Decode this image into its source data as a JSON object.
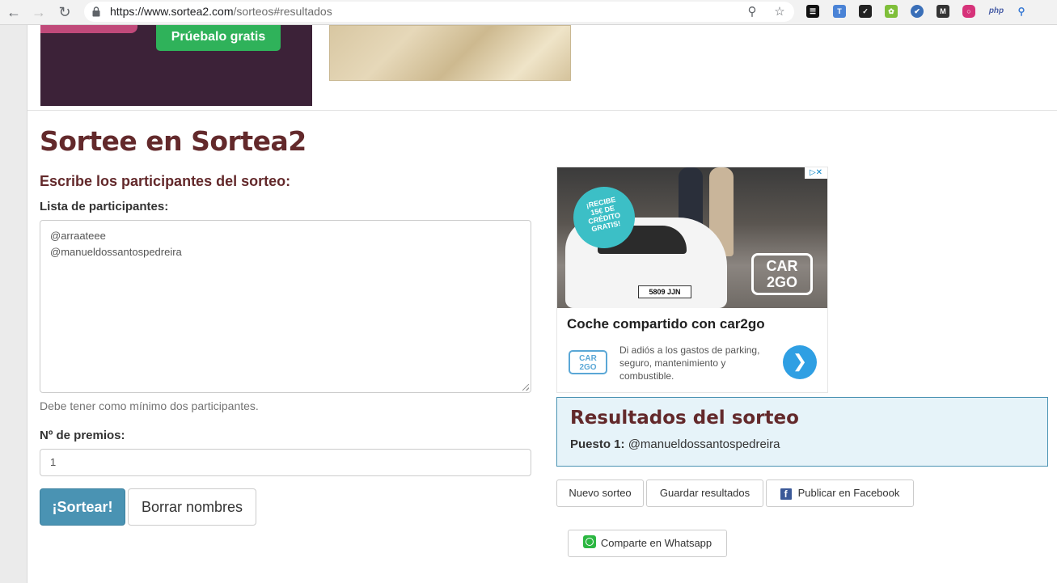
{
  "browser": {
    "url_host": "https://www.sortea2.com",
    "url_path": "/sorteos#resultados",
    "extensions": [
      "layers-icon",
      "translate-icon",
      "checklist-icon",
      "gear-flower-icon",
      "shield-icon",
      "m-icon",
      "instagram-icon",
      "php",
      "search-icon"
    ]
  },
  "top_banner": {
    "cta_label": "Prúebalo gratis"
  },
  "main": {
    "title": "Sortee en Sortea2",
    "subtitle": "Escribe los participantes del sorteo:",
    "participants_label": "Lista de participantes:",
    "participants": [
      "@arraateee",
      "@manueldossantospedreira"
    ],
    "help_text": "Debe tener como mínimo dos participantes.",
    "prizes_label": "Nº de premios:",
    "prizes_value": "1",
    "draw_button": "¡Sortear!",
    "clear_button": "Borrar nombres"
  },
  "ad": {
    "badge_lines": [
      "¡RECIBE",
      "15€ DE",
      "CRÉDITO",
      "GRATIS!"
    ],
    "logo_text": [
      "CAR",
      "2GO"
    ],
    "plate": "5809 JJN",
    "headline": "Coche compartido con car2go",
    "body": "Di adiós a los gastos de parking, seguro, mantenimiento y combustible."
  },
  "results": {
    "title": "Resultados del sorteo",
    "position_label": "Puesto 1:",
    "winner": "@manueldossantospedreira"
  },
  "actions": {
    "new_draw": "Nuevo sorteo",
    "save_results": "Guardar resultados",
    "publish_facebook": "Publicar en Facebook",
    "share_whatsapp": "Comparte en Whatsapp"
  },
  "colors": {
    "brand": "#63292b",
    "primary_button": "#4a93b3",
    "results_bg": "#e6f3f9"
  }
}
